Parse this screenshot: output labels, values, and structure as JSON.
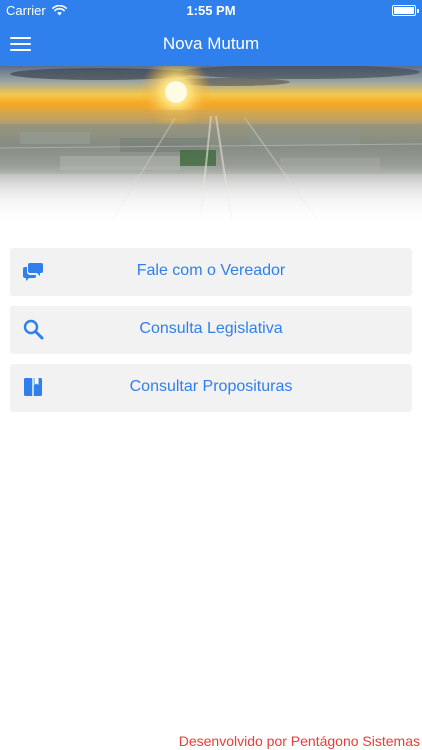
{
  "status_bar": {
    "carrier": "Carrier",
    "time": "1:55 PM"
  },
  "nav": {
    "title": "Nova Mutum"
  },
  "menu": [
    {
      "label": "Fale com o Vereador",
      "icon": "chat-icon"
    },
    {
      "label": "Consulta Legislativa",
      "icon": "search-icon"
    },
    {
      "label": "Consultar Proposituras",
      "icon": "book-icon"
    }
  ],
  "footer": {
    "text": "Desenvolvido por Pentágono Sistemas"
  },
  "colors": {
    "primary": "#2f80ed",
    "footer": "#eb3b3b",
    "item_bg": "#f2f2f2"
  }
}
